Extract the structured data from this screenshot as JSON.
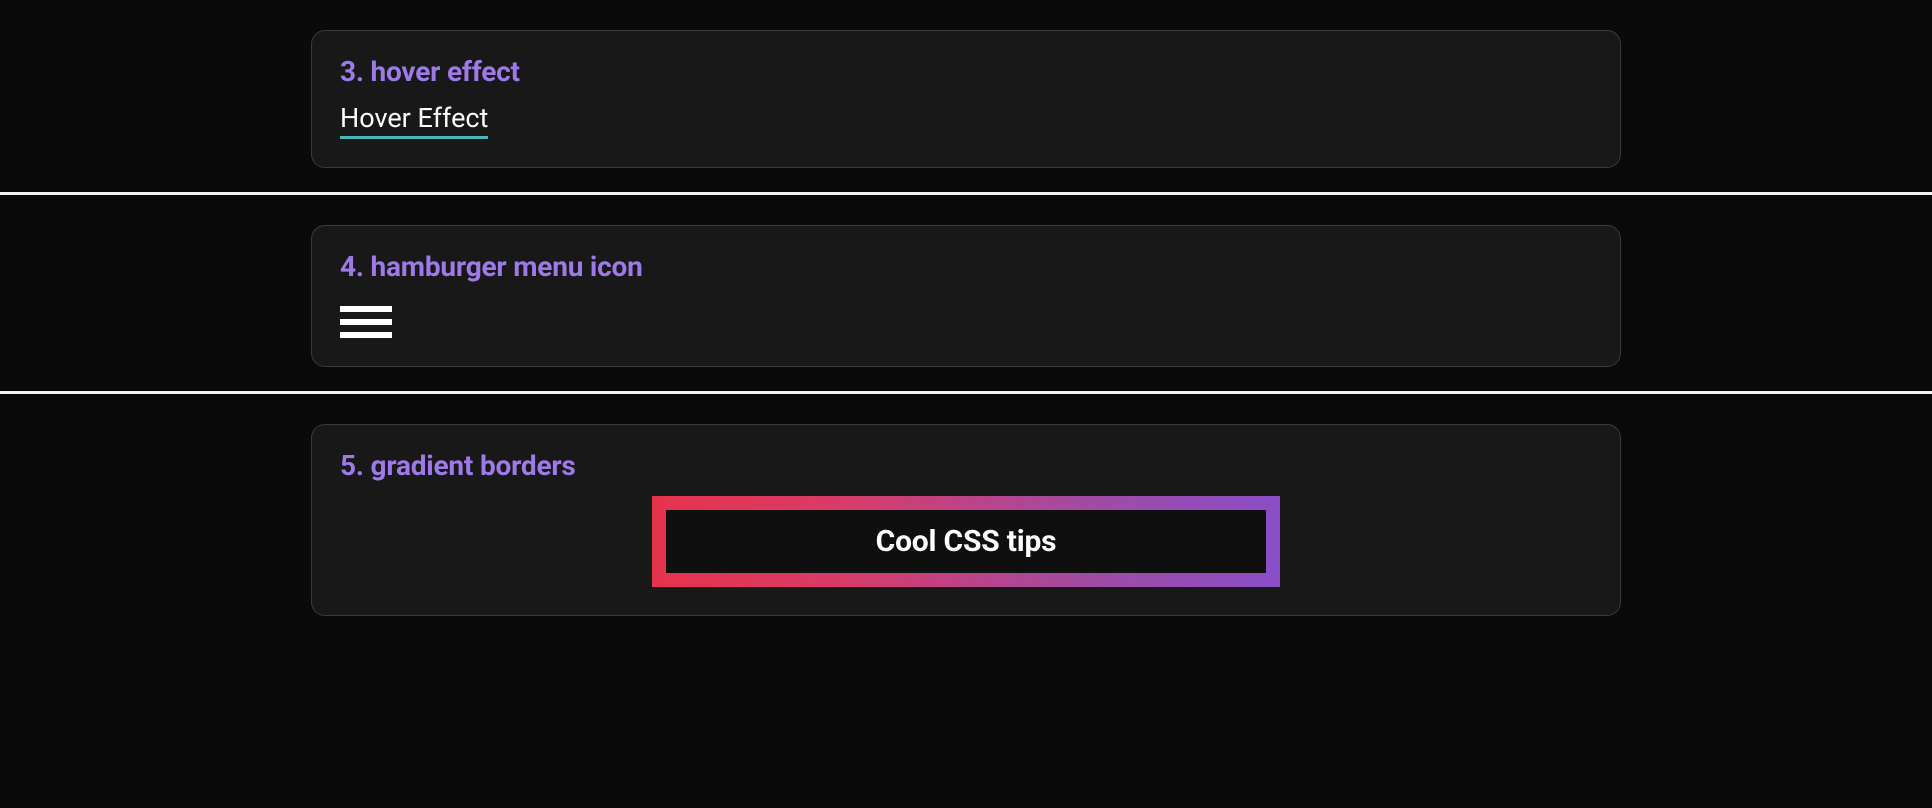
{
  "sections": {
    "hover_effect": {
      "heading": "3. hover effect",
      "link_text": "Hover Effect"
    },
    "hamburger": {
      "heading": "4. hamburger menu icon"
    },
    "gradient_borders": {
      "heading": "5. gradient borders",
      "inner_text": "Cool CSS tips"
    }
  },
  "colors": {
    "heading": "#9d7ae7",
    "card_bg": "#181818",
    "body_bg": "#0a0a0a",
    "underline": "#4bb6b7",
    "gradient_start": "#e6334c",
    "gradient_end": "#8a4ec8"
  }
}
